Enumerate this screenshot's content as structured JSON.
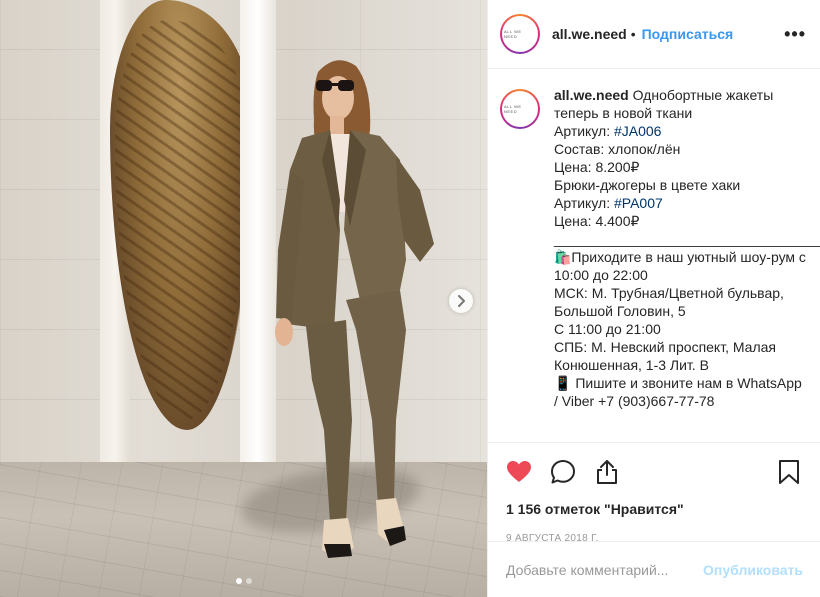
{
  "post": {
    "username": "all.we.need",
    "avatar_text": "ALL WE NEED",
    "separator": "•",
    "follow_label": "Подписаться",
    "more_icon": "more-horizontal-icon",
    "caption_username": "all.we.need",
    "caption_lines": [
      {
        "t": "Однобортные жакеты теперь в новой ткани"
      },
      {
        "t": "Артикул: ",
        "tag": "#JA006"
      },
      {
        "t": "Состав: хлопок/лён"
      },
      {
        "t": "Цена: 8.200₽"
      },
      {
        "t": "Брюки-джогеры в цвете хаки"
      },
      {
        "t": "Артикул: ",
        "tag": "#PA007"
      },
      {
        "t": "Цена: 4.400₽"
      },
      {
        "t": "____________________________________"
      },
      {
        "t": "🛍️Приходите в наш уютный шоу-рум с 10:00 до 22:00"
      },
      {
        "t": "МСК: М. Трубная/Цветной бульвар, Большой Головин, 5"
      },
      {
        "t": "С 11:00 до 21:00"
      },
      {
        "t": "СПБ: М. Невский проспект, Малая Конюшенная, 1-3 Лит. В"
      },
      {
        "t": "📱 Пишите и звоните нам в WhatsApp / Viber +7 (903)667-77-78"
      }
    ],
    "likes": "1 156 отметок \"Нравится\"",
    "date": "9 августа 2018 г.",
    "comment_placeholder": "Добавьте комментарий...",
    "publish_label": "Опубликовать",
    "liked": true,
    "carousel": {
      "slides": 2,
      "active": 1
    },
    "colors": {
      "link": "#3897f0",
      "hashtag": "#003569",
      "like": "#ed4956",
      "publish_disabled": "#b2dffc"
    }
  }
}
